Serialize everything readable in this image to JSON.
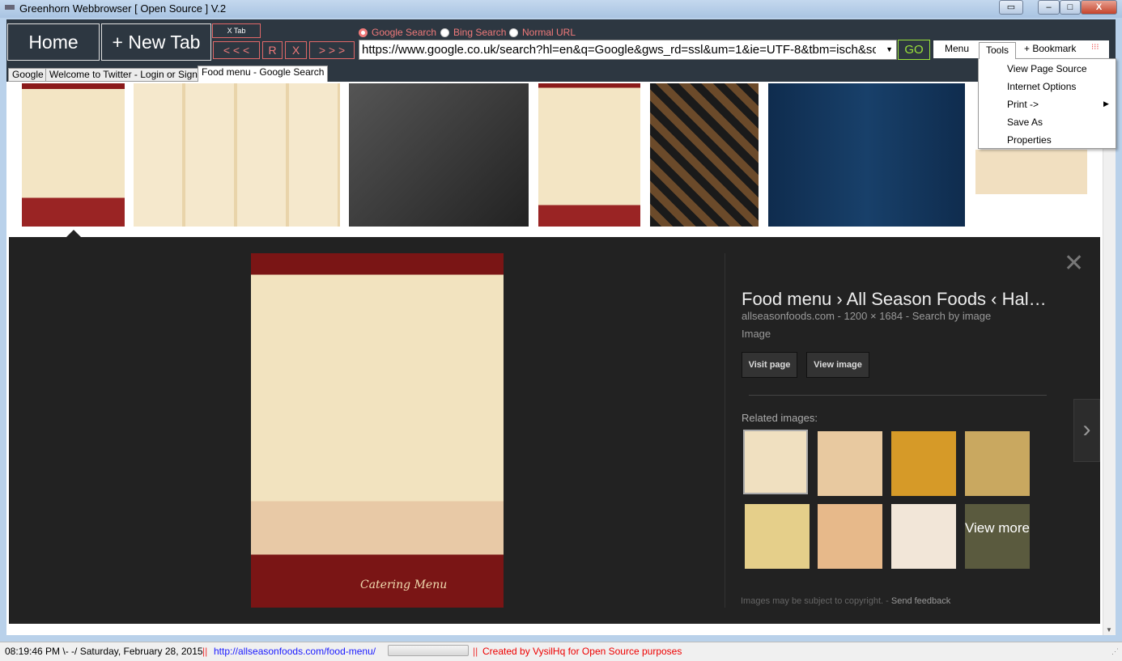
{
  "window": {
    "title": "Greenhorn Webbrowser [ Open Source ] V.2"
  },
  "toolbar": {
    "home": "Home",
    "new_tab": "+ New Tab",
    "close_tab": "X Tab",
    "back": "< < <",
    "refresh": "R",
    "stop": "X",
    "forward": "> > >",
    "search_options": [
      {
        "label": "Google Search",
        "selected": true
      },
      {
        "label": "Bing Search",
        "selected": false
      },
      {
        "label": "Normal URL",
        "selected": false
      }
    ],
    "url": "https://www.google.co.uk/search?hl=en&q=Google&gws_rd=ssl&um=1&ie=UTF-8&tbm=isch&source=og",
    "go": "GO",
    "menu": "Menu",
    "tools": "Tools",
    "bookmark": "+ Bookmark"
  },
  "tools_menu": [
    "View  Page Source",
    "Internet Options",
    "Print ->",
    "Save As",
    "Properties"
  ],
  "tabs": [
    "Google",
    "Welcome to Twitter - Login or Sign up",
    "Food menu - Google Search"
  ],
  "active_tab": 2,
  "preview": {
    "title": "Food menu › All Season Foods ‹ Hal…",
    "site": "allseasonfoods.com",
    "dims": "1200 × 1684",
    "search_by_image": "Search by image",
    "type": "Image",
    "visit": "Visit page",
    "view": "View image",
    "related": "Related images:",
    "view_more": "View more",
    "copyright": "Images may be subject to copyright.",
    "feedback": "Send feedback",
    "image_caption": "Catering Menu"
  },
  "status": {
    "time": "08:19:46 PM \\- -/ Saturday, February 28, 2015",
    "sep": "||",
    "link": "http://allseasonfoods.com/food-menu/",
    "credit": "Created by VysilHq for Open Source purposes"
  },
  "colors": {
    "toolbar": "#2d3741",
    "accent": "#f07a7a",
    "go": "#9be23a",
    "panel": "#222222"
  }
}
